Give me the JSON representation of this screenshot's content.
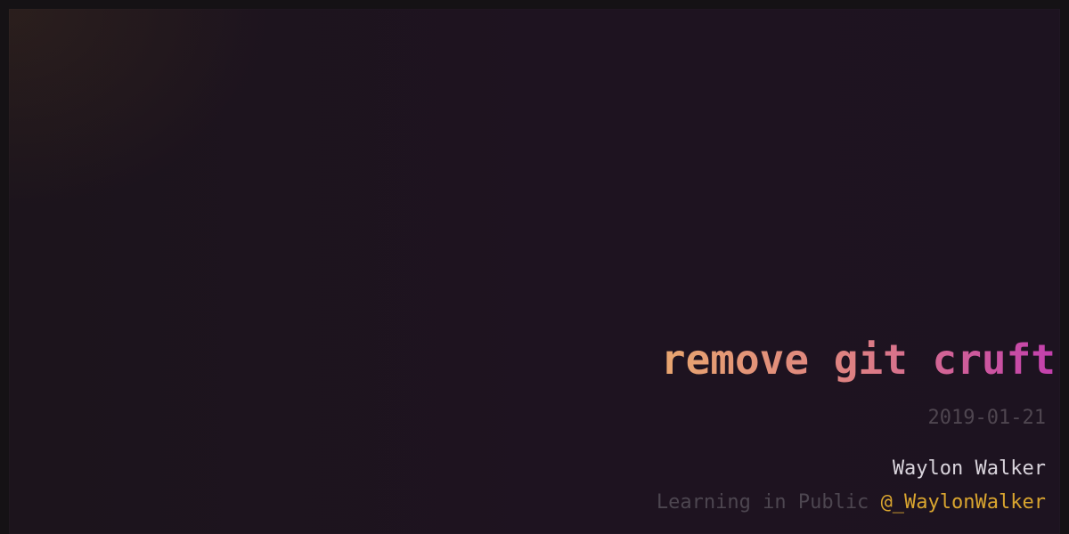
{
  "post": {
    "title": "remove git cruft",
    "date": "2019-01-21",
    "author": "Waylon Walker",
    "tagline_text": "Learning in Public",
    "handle": "@_WaylonWalker"
  },
  "colors": {
    "title_gradient_start": "#e8a66f",
    "title_gradient_end": "#c33fae",
    "handle": "#d9a52f",
    "author": "#d9d4dc",
    "muted": "#4d4650",
    "background": "#1d1320"
  }
}
